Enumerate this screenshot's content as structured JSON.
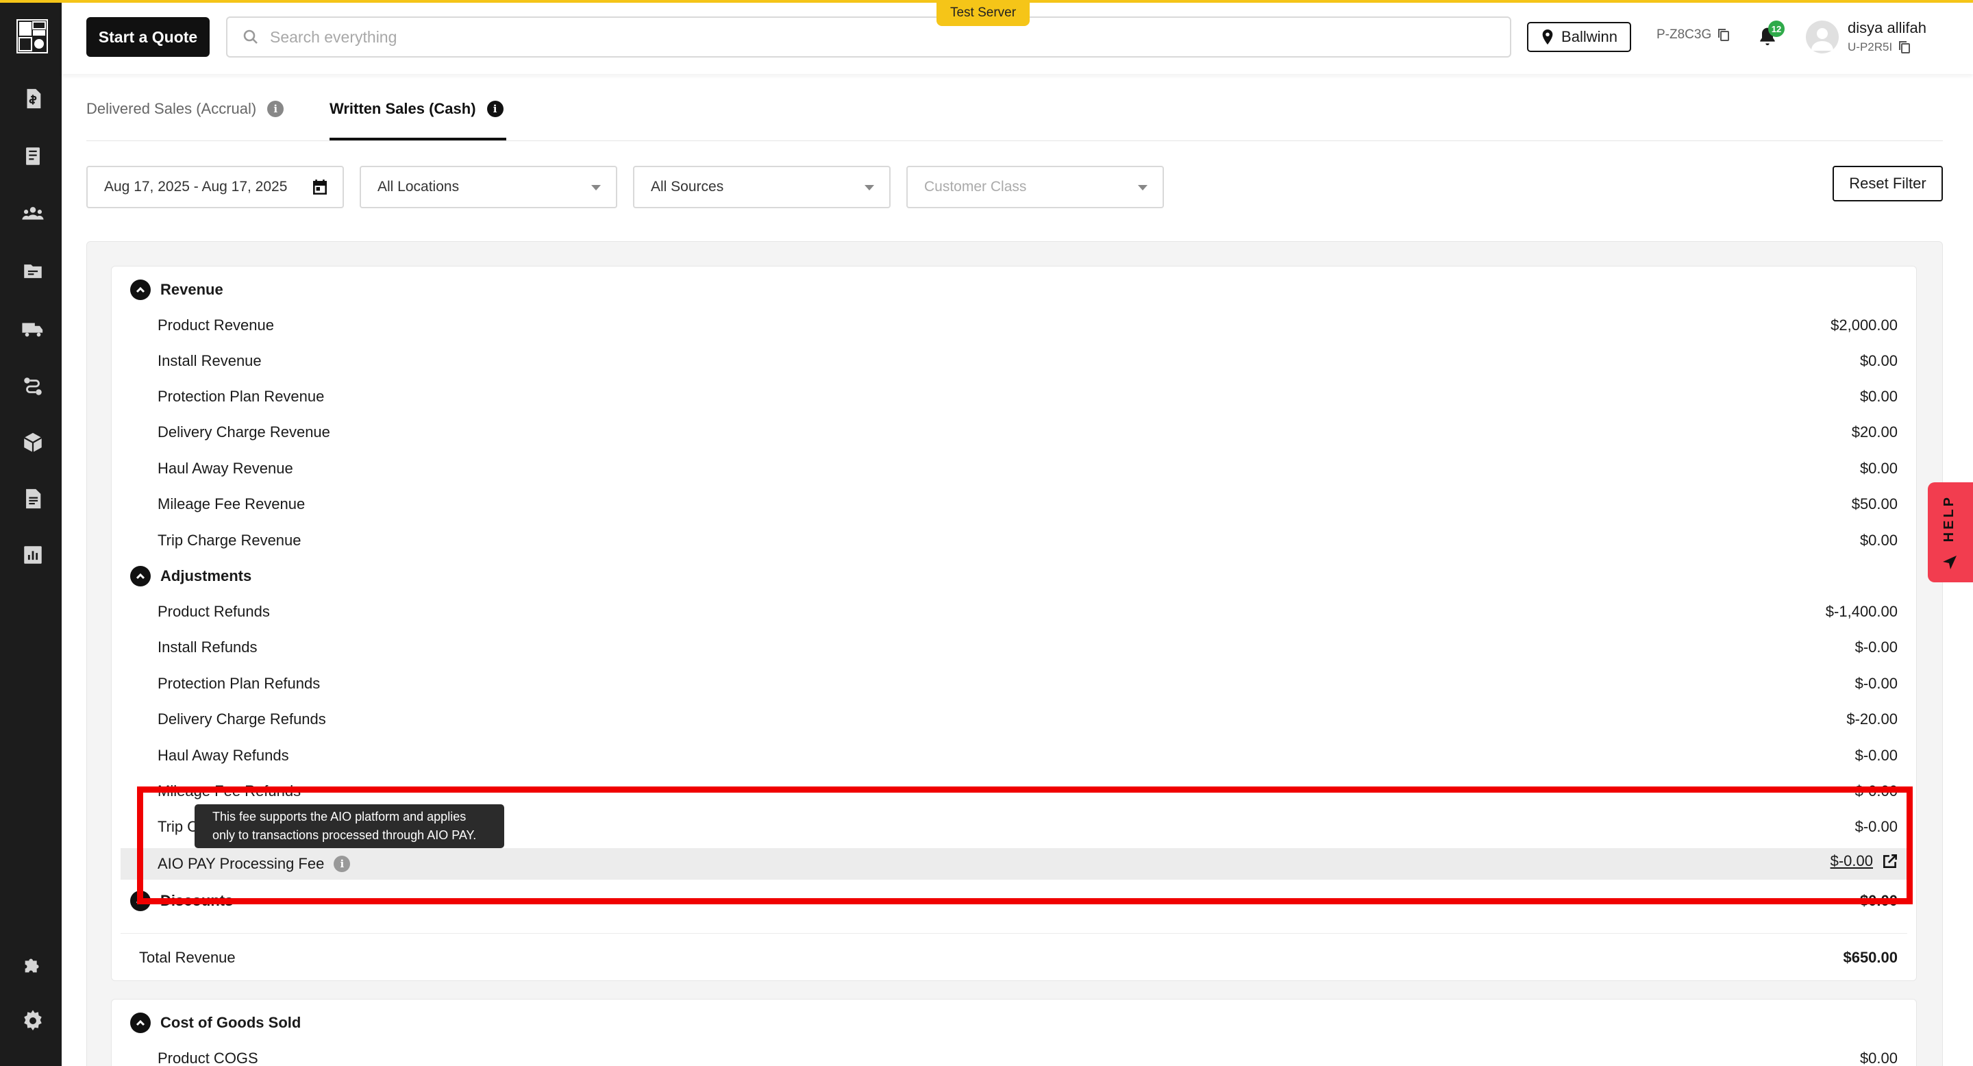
{
  "header": {
    "start_quote_label": "Start a Quote",
    "search_placeholder": "Search everything",
    "server_badge": "Test Server",
    "location": "Ballwinn",
    "company_code": "P-Z8C3G",
    "notification_count": "12",
    "user_name": "disya allifah",
    "user_id": "U-P2R5I"
  },
  "tabs": [
    {
      "label": "Delivered Sales (Accrual)",
      "active": false
    },
    {
      "label": "Written Sales (Cash)",
      "active": true
    }
  ],
  "filters": {
    "date_range": "Aug 17, 2025 - Aug 17, 2025",
    "location": "All Locations",
    "source": "All Sources",
    "customer_class_placeholder": "Customer Class",
    "reset_label": "Reset Filter"
  },
  "report": {
    "revenue": {
      "title": "Revenue",
      "rows": [
        {
          "label": "Product Revenue",
          "value": "$2,000.00"
        },
        {
          "label": "Install Revenue",
          "value": "$0.00"
        },
        {
          "label": "Protection Plan Revenue",
          "value": "$0.00"
        },
        {
          "label": "Delivery Charge Revenue",
          "value": "$20.00"
        },
        {
          "label": "Haul Away Revenue",
          "value": "$0.00"
        },
        {
          "label": "Mileage Fee Revenue",
          "value": "$50.00"
        },
        {
          "label": "Trip Charge Revenue",
          "value": "$0.00"
        }
      ]
    },
    "adjustments": {
      "title": "Adjustments",
      "rows": [
        {
          "label": "Product Refunds",
          "value": "$-1,400.00"
        },
        {
          "label": "Install Refunds",
          "value": "$-0.00"
        },
        {
          "label": "Protection Plan Refunds",
          "value": "$-0.00"
        },
        {
          "label": "Delivery Charge Refunds",
          "value": "$-20.00"
        },
        {
          "label": "Haul Away Refunds",
          "value": "$-0.00"
        },
        {
          "label": "Mileage Fee Refunds",
          "value": "$-0.00"
        },
        {
          "label": "Trip Charge Refunds",
          "value": "$-0.00"
        }
      ],
      "aio_fee": {
        "label": "AIO PAY Processing Fee",
        "value": "$-0.00",
        "tooltip_line1": "This fee supports the AIO platform and applies",
        "tooltip_line2": "only to transactions processed through AIO PAY."
      }
    },
    "discounts": {
      "title": "Discounts",
      "value": "$0.00"
    },
    "total": {
      "label": "Total Revenue",
      "value": "$650.00"
    },
    "cogs": {
      "title": "Cost of Goods Sold",
      "rows": [
        {
          "label": "Product COGS",
          "value": "$0.00"
        }
      ]
    }
  },
  "help_label": "HELP",
  "colors": {
    "accent": "#f5c518",
    "sidebar": "#1c1c1c",
    "highlight": "#f00000",
    "help": "#f23d4f",
    "badge": "#2faa4a"
  }
}
